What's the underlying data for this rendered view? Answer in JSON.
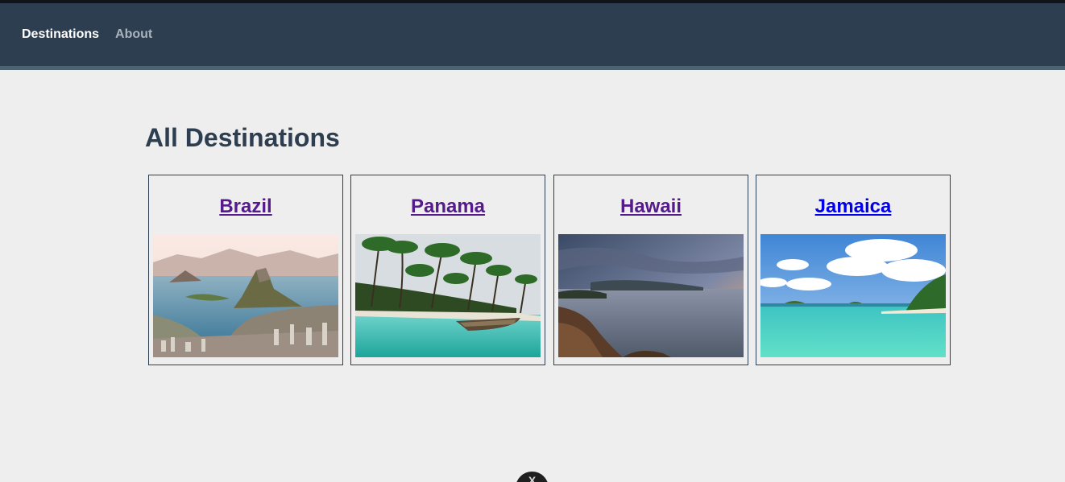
{
  "nav": {
    "items": [
      {
        "label": "Destinations",
        "active": true
      },
      {
        "label": "About",
        "active": false
      }
    ]
  },
  "main": {
    "title": "All Destinations",
    "destinations": [
      {
        "name": "Brazil",
        "link_color": "#551a8b",
        "image": "rio-de-janeiro-bay-photo"
      },
      {
        "name": "Panama",
        "link_color": "#551a8b",
        "image": "palm-beach-boat-photo"
      },
      {
        "name": "Hawaii",
        "link_color": "#551a8b",
        "image": "rocky-coast-sunset-photo"
      },
      {
        "name": "Jamaica",
        "link_color": "#0000ee",
        "image": "turquoise-lagoon-photo"
      }
    ]
  },
  "floating_button": {
    "icon": "close-icon",
    "glyph": "X"
  },
  "colors": {
    "navbar": "#2e3e51",
    "background": "#eeeeee",
    "visited_link": "#551a8b",
    "link": "#0000ee"
  }
}
